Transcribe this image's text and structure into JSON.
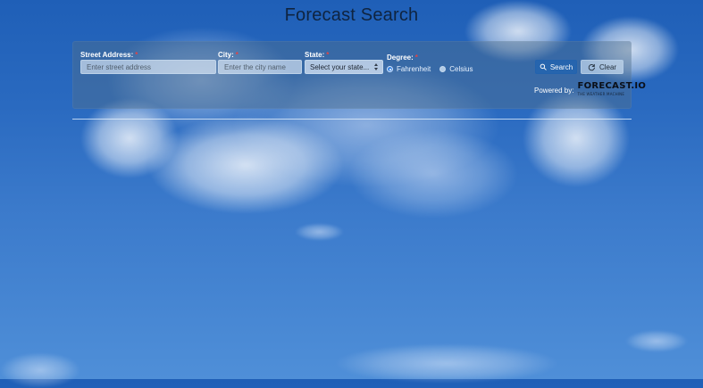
{
  "page": {
    "title": "Forecast Search"
  },
  "form": {
    "street": {
      "label": "Street Address:",
      "placeholder": "Enter street address",
      "value": ""
    },
    "city": {
      "label": "City:",
      "placeholder": "Enter the city name",
      "value": ""
    },
    "state": {
      "label": "State:",
      "selected": "Select your state..."
    },
    "degree": {
      "label": "Degree:",
      "options": [
        {
          "label": "Fahrenheit",
          "selected": true
        },
        {
          "label": "Celsius",
          "selected": false
        }
      ]
    },
    "required_marker": "*"
  },
  "actions": {
    "search_label": "Search",
    "clear_label": "Clear"
  },
  "powered_by": {
    "label": "Powered by:",
    "brand": "FORECAST.IO",
    "brand_sub": "THE WEATHER MACHINE"
  },
  "colors": {
    "accent": "#2a7be0",
    "required": "#e04444",
    "panel_bg": "rgba(80,110,140,0.45)"
  },
  "icons": {
    "search": "search-icon",
    "clear": "refresh-icon",
    "select": "select-arrows-icon"
  }
}
